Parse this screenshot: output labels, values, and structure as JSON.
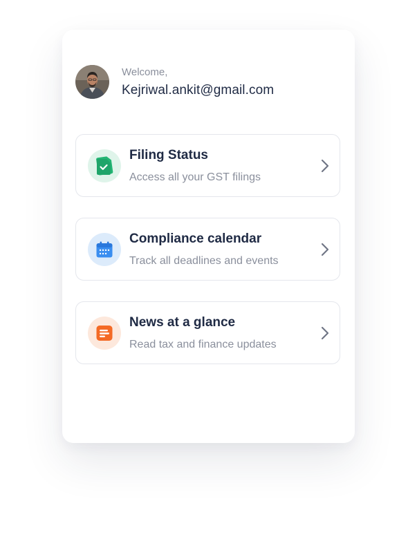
{
  "profile": {
    "welcome": "Welcome,",
    "email": "Kejriwal.ankit@gmail.com"
  },
  "menu": {
    "items": [
      {
        "title": "Filing Status",
        "subtitle": "Access all your GST filings",
        "icon": "document-check-icon",
        "accent": "#22b573",
        "tint": "#dff4ea"
      },
      {
        "title": "Compliance calendar",
        "subtitle": "Track all deadlines and events",
        "icon": "calendar-icon",
        "accent": "#3a8ef0",
        "tint": "#dcebfb"
      },
      {
        "title": "News at a glance",
        "subtitle": "Read tax and finance updates",
        "icon": "newspaper-icon",
        "accent": "#f46a25",
        "tint": "#fde8dc"
      }
    ]
  }
}
